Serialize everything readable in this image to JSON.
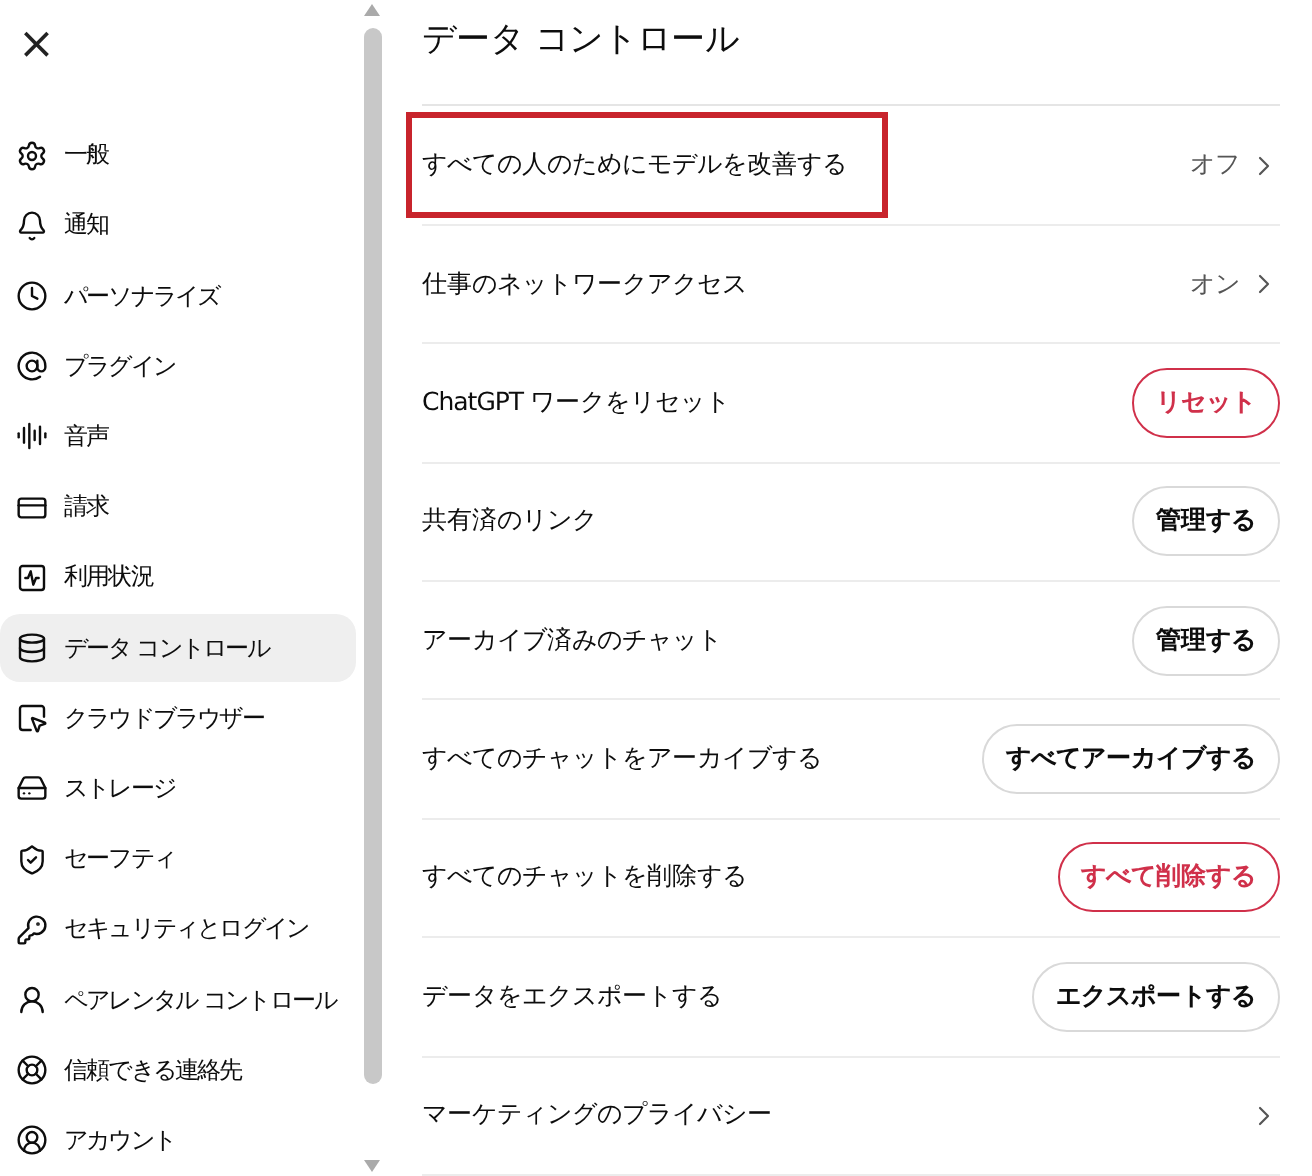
{
  "sidebar": {
    "close": "×",
    "items": [
      {
        "label": "一般",
        "selected": false
      },
      {
        "label": "通知",
        "selected": false
      },
      {
        "label": "パーソナライズ",
        "selected": false
      },
      {
        "label": "プラグイン",
        "selected": false
      },
      {
        "label": "音声",
        "selected": false
      },
      {
        "label": "請求",
        "selected": false
      },
      {
        "label": "利用状況",
        "selected": false
      },
      {
        "label": "データ コントロール",
        "selected": true
      },
      {
        "label": "クラウドブラウザー",
        "selected": false
      },
      {
        "label": "ストレージ",
        "selected": false
      },
      {
        "label": "セーフティ",
        "selected": false
      },
      {
        "label": "セキュリティとログイン",
        "selected": false
      },
      {
        "label": "ペアレンタル コントロール",
        "selected": false
      },
      {
        "label": "信頼できる連絡先",
        "selected": false
      },
      {
        "label": "アカウント",
        "selected": false
      }
    ]
  },
  "panel": {
    "title": "データ コントロール",
    "rows": [
      {
        "kind": "value",
        "label": "すべての人のためにモデルを改善する",
        "value": "オフ",
        "highlighted": true
      },
      {
        "kind": "value",
        "label": "仕事のネットワークアクセス",
        "value": "オン",
        "highlighted": false
      },
      {
        "kind": "button",
        "label": "ChatGPT ワークをリセット",
        "button": "リセット",
        "danger": true,
        "highlighted": false
      },
      {
        "kind": "button",
        "label": "共有済のリンク",
        "button": "管理する",
        "danger": false,
        "highlighted": false
      },
      {
        "kind": "button",
        "label": "アーカイブ済みのチャット",
        "button": "管理する",
        "danger": false,
        "highlighted": false
      },
      {
        "kind": "button",
        "label": "すべてのチャットをアーカイブする",
        "button": "すべてアーカイブする",
        "danger": false,
        "highlighted": false
      },
      {
        "kind": "button",
        "label": "すべてのチャットを削除する",
        "button": "すべて削除する",
        "danger": true,
        "highlighted": false
      },
      {
        "kind": "button",
        "label": "データをエクスポートする",
        "button": "エクスポートする",
        "danger": false,
        "highlighted": false
      },
      {
        "kind": "link",
        "label": "マーケティングのプライバシー",
        "highlighted": false
      }
    ]
  }
}
